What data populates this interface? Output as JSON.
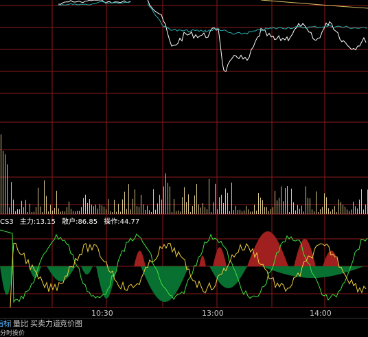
{
  "time_axis": {
    "labels": [
      "10:30",
      "13:00",
      "14:00"
    ]
  },
  "indicator": {
    "name": "CS3",
    "main_label": "主力:13.15",
    "retail_label": "散户:86.85",
    "operate_label": "操作:44.77",
    "colors": {
      "main": "#f0d040",
      "retail": "#40e040",
      "positive_fill": "#a02020",
      "negative_fill": "#087030"
    }
  },
  "tabs": [
    {
      "label": "指标",
      "active": true
    },
    {
      "label": "量比",
      "active": false
    },
    {
      "label": "买卖力道",
      "active": false
    },
    {
      "label": "竞价图",
      "active": false
    }
  ],
  "bottom_partial_text": "分时投价",
  "colors": {
    "background": "#000000",
    "grid": "#8b1a1a",
    "price_line": "#ffffff",
    "avg_line": "#27b0b0",
    "volume_bar": "#d9c88a"
  }
}
